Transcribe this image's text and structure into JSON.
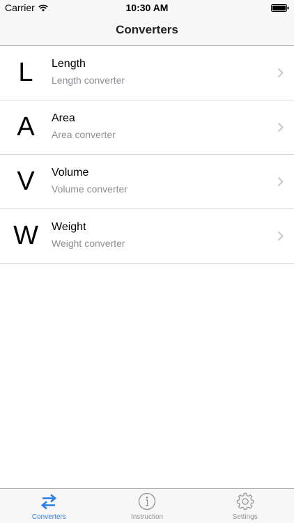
{
  "status_bar": {
    "carrier": "Carrier",
    "time": "10:30 AM",
    "wifi_icon": "wifi-icon",
    "battery_icon": "battery-icon"
  },
  "nav": {
    "title": "Converters"
  },
  "converters": [
    {
      "letter": "L",
      "title": "Length",
      "subtitle": "Length converter"
    },
    {
      "letter": "A",
      "title": "Area",
      "subtitle": "Area converter"
    },
    {
      "letter": "V",
      "title": "Volume",
      "subtitle": "Volume converter"
    },
    {
      "letter": "W",
      "title": "Weight",
      "subtitle": "Weight converter"
    }
  ],
  "tab_bar": {
    "tabs": [
      {
        "label": "Converters",
        "icon": "swap-arrows-icon",
        "active": true
      },
      {
        "label": "Instruction",
        "icon": "info-icon",
        "active": false
      },
      {
        "label": "Settings",
        "icon": "gear-icon",
        "active": false
      }
    ]
  },
  "colors": {
    "accent": "#2a7ce8",
    "inactive_tab": "#929292",
    "subtitle": "#8e8e93",
    "bar_background": "#f7f7f7",
    "separator": "#d6d6d8"
  }
}
